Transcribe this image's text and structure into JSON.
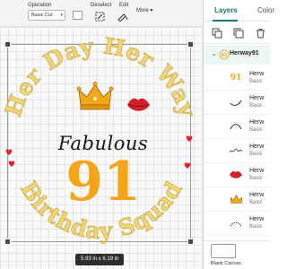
{
  "toolbar": {
    "operation_label": "Operation",
    "operation_value": "Basic Cut",
    "deselect_label": "Deselect",
    "edit_label": "Edit",
    "more_label": "More",
    "swatch_color": "#ffffff"
  },
  "canvas": {
    "dimensions": "5.93  in x 6.19  in",
    "design": {
      "arc_top_text": "Her Day Her Way",
      "arc_bottom_text": "Birthday Squad",
      "script_text": "Fabulous",
      "number_text": "91",
      "gold_color": "#eed57a",
      "number_color": "#f6a315",
      "heart_color": "#e0242a",
      "lips_color": "#d31f2a"
    }
  },
  "panel": {
    "tabs": [
      {
        "label": "Layers"
      },
      {
        "label": "Color"
      }
    ],
    "group_name": "Herway91",
    "layers": [
      {
        "name": "Herw",
        "type": "Basic",
        "icon": "number-91-thumb"
      },
      {
        "name": "Herw",
        "type": "Basic",
        "icon": "swoosh-thumb"
      },
      {
        "name": "Herw",
        "type": "Basic",
        "icon": "arc-thumb"
      },
      {
        "name": "Herw",
        "type": "Basic",
        "icon": "script-thumb"
      },
      {
        "name": "Herw",
        "type": "Basic",
        "icon": "lips-thumb"
      },
      {
        "name": "Herw",
        "type": "Basic",
        "icon": "crown-thumb"
      },
      {
        "name": "Herw",
        "type": "Basic",
        "icon": "text-thumb"
      }
    ],
    "blank_canvas_label": "Blank Canvas"
  }
}
